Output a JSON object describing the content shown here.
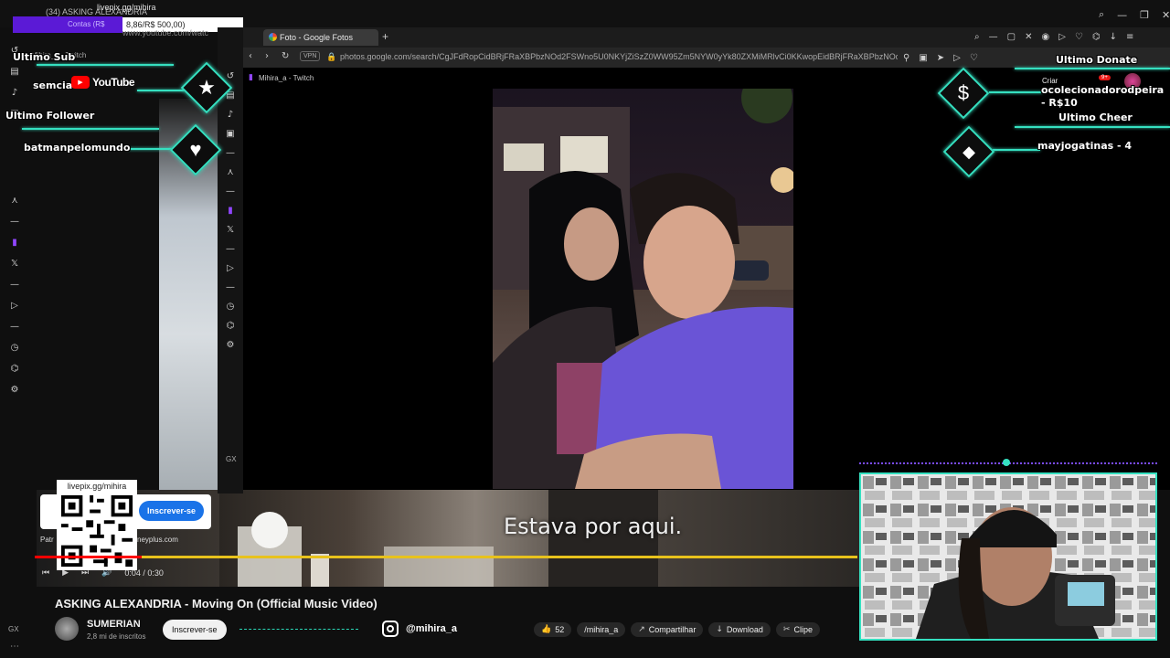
{
  "bg_browser": {
    "tab_title": "(34) ASKING ALEXANDRIA",
    "livepix_top": "livepix.gg/mihira",
    "counter_label": "Contas (R$",
    "counter_value": "8,86/R$ 500,00)",
    "url": "www.youtube.com/watc",
    "sub_tab": "Mihira_a - Twitch"
  },
  "overlay": {
    "last_sub_label": "Ultimo Sub",
    "last_sub_value": "semcia",
    "youtube_label": "YouTube",
    "last_follower_label": "Ultimo Follower",
    "last_follower_value": "batmanpelomundo",
    "last_donate_label": "Ultimo Donate",
    "last_donate_value_1": "ocolecionadorodpeira",
    "last_donate_value_2": "- R$10",
    "last_cheer_label": "Ultimo Cheer",
    "last_cheer_value": "mayjogatinas - 4",
    "star_icon": "star-icon",
    "heart_icon": "heart-icon",
    "dollar_icon": "dollar-icon",
    "diamond_icon": "diamond-icon",
    "accent": "#35e0c0"
  },
  "photos_window": {
    "tab_label": "Foto - Google Fotos",
    "vpn_label": "VPN",
    "url": "photos.google.com/search/CgJFdRopCidBRjFRaXBPbzNOd2FSWno5U0NKYjZiSzZ0WW95Zm5NYW0yYk80ZXMiMRlvCi0KKwopEidBRjFRaXBPbzNOd2FSWno5",
    "bookmark": "Mihira_a - Twitch",
    "twitch_create": "Criar",
    "notif_badge": "9+"
  },
  "youtube": {
    "subtitle": "Estava por aqui.",
    "time": "0:04 / 0:30",
    "progress": 0.13,
    "title": "ASKING ALEXANDRIA - Moving On (Official Music Video)",
    "channel": "SUMERIAN",
    "subs": "2,8 mi de inscritos",
    "subscribe": "Inscrever-se",
    "instagram": "@mihira_a",
    "likes": "52",
    "handle_overlay": "/mihira_a",
    "share": "Compartilhar",
    "download": "Download",
    "clip": "Clipe"
  },
  "qr": {
    "label": "livepix.gg/mihira",
    "card_subscribe": "Inscrever-se",
    "patreon": "Patr",
    "dplus": "neyplus.com"
  }
}
